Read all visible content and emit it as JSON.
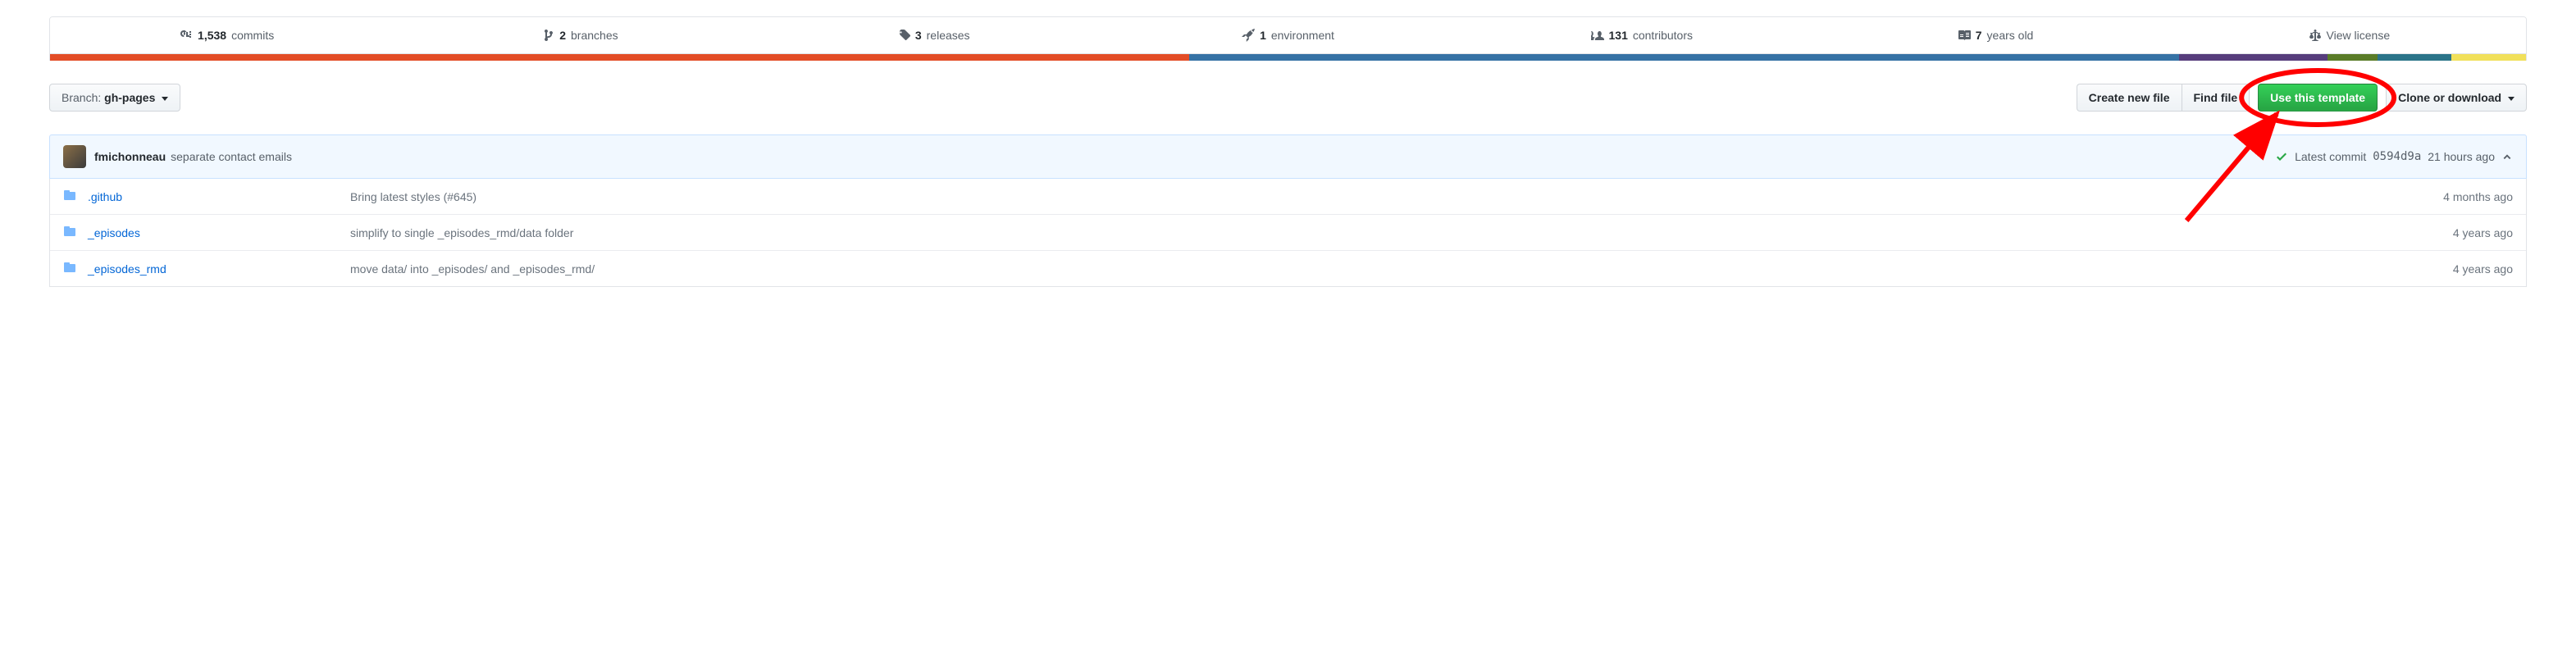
{
  "stats": {
    "commits": {
      "num": "1,538",
      "label": "commits"
    },
    "branches": {
      "num": "2",
      "label": "branches"
    },
    "releases": {
      "num": "3",
      "label": "releases"
    },
    "environments": {
      "num": "1",
      "label": "environment"
    },
    "contributors": {
      "num": "131",
      "label": "contributors"
    },
    "age": {
      "num": "7",
      "label": "years old"
    },
    "license": {
      "label": "View license"
    }
  },
  "languages": [
    {
      "color": "#e34c26",
      "percent": 46
    },
    {
      "color": "#3572A5",
      "percent": 40
    },
    {
      "color": "#563d7c",
      "percent": 6
    },
    {
      "color": "#5a7c28",
      "percent": 2
    },
    {
      "color": "#2b7489",
      "percent": 3
    },
    {
      "color": "#f1e05a",
      "percent": 3
    }
  ],
  "branch": {
    "label": "Branch:",
    "value": "gh-pages"
  },
  "actions": {
    "create": "Create new file",
    "find": "Find file",
    "template": "Use this template",
    "clone": "Clone or download"
  },
  "commit": {
    "author": "fmichonneau",
    "message": "separate contact emails",
    "latest_label": "Latest commit",
    "hash": "0594d9a",
    "time": "21 hours ago"
  },
  "files": [
    {
      "name": ".github",
      "msg": "Bring latest styles (#645)",
      "time": "4 months ago"
    },
    {
      "name": "_episodes",
      "msg": "simplify to single _episodes_rmd/data folder",
      "time": "4 years ago"
    },
    {
      "name": "_episodes_rmd",
      "msg": "move data/ into _episodes/ and _episodes_rmd/",
      "time": "4 years ago"
    }
  ]
}
